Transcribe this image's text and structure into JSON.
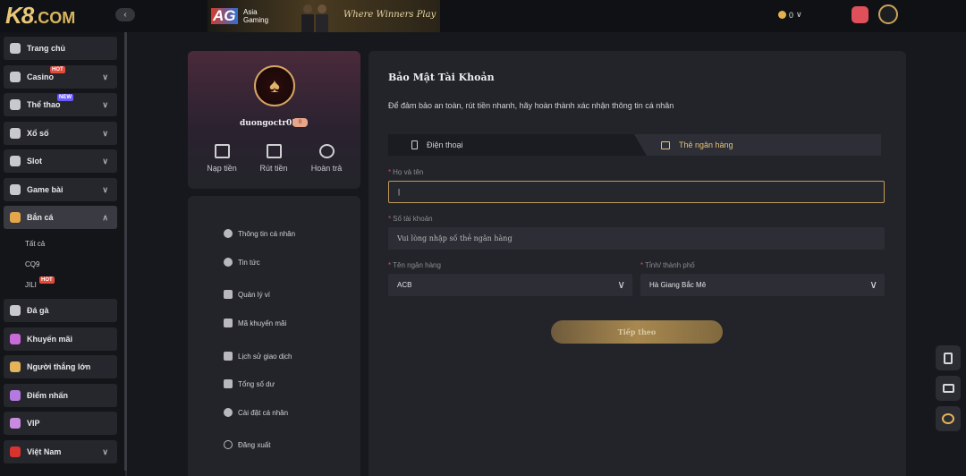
{
  "header": {
    "logo": "K8",
    "logo_suffix": ".COM",
    "collapse": "‹",
    "banner_brand": "AG",
    "banner_brand_sub": "Asia Gaming",
    "banner_slogan": "Where Winners Play",
    "balance": "0",
    "balance_caret": "∨"
  },
  "sidebar": {
    "items": [
      {
        "label": "Trang chủ"
      },
      {
        "label": "Casino",
        "badge": "HOT"
      },
      {
        "label": "Thể thao",
        "badge": "NEW"
      },
      {
        "label": "Xổ số"
      },
      {
        "label": "Slot"
      },
      {
        "label": "Game bài"
      },
      {
        "label": "Bắn cá"
      },
      {
        "label": "Đá gà"
      },
      {
        "label": "Khuyến mãi"
      },
      {
        "label": "Người thắng lớn"
      },
      {
        "label": "Điểm nhấn"
      },
      {
        "label": "VIP"
      },
      {
        "label": "Việt Nam"
      }
    ],
    "sub_items": [
      {
        "label": "Tất cả"
      },
      {
        "label": "CQ9"
      },
      {
        "label": "JILI",
        "badge": "HOT"
      }
    ]
  },
  "profile": {
    "username": "duongoctr02",
    "vip": "0",
    "actions": [
      {
        "label": "Nạp tiền"
      },
      {
        "label": "Rút tiền"
      },
      {
        "label": "Hoàn trả"
      }
    ]
  },
  "menu": {
    "items": [
      {
        "label": "Thông tin cá nhân"
      },
      {
        "label": "Tin tức"
      },
      {
        "label": "Quản lý ví"
      },
      {
        "label": "Mã khuyến mãi"
      },
      {
        "label": "Lịch sử giao dịch"
      },
      {
        "label": "Tổng số dư"
      },
      {
        "label": "Cài đặt cá nhân"
      },
      {
        "label": "Đăng xuất"
      }
    ]
  },
  "main": {
    "title": "Bảo Mật Tài Khoản",
    "description": "Để đảm bảo an toàn, rút tiền nhanh, hãy hoàn thành xác nhận thông tin cá nhân",
    "tabs": [
      {
        "label": "Điện thoại"
      },
      {
        "label": "Thẻ ngân hàng"
      }
    ],
    "fields": {
      "name_label": "Họ và tên",
      "name_value": "|",
      "account_label": "Số tài khoản",
      "account_placeholder": "Vui lòng nhập số thẻ ngân hàng",
      "bank_label": "Tên ngân hàng",
      "bank_value": "ACB",
      "province_label": "Tỉnh/ thành phố",
      "province_value": "Hà Giang  Bắc Mê"
    },
    "submit": "Tiếp theo"
  },
  "colors": {
    "accent": "#c39b5c",
    "required": "#e0484e",
    "panel": "#23242a"
  }
}
